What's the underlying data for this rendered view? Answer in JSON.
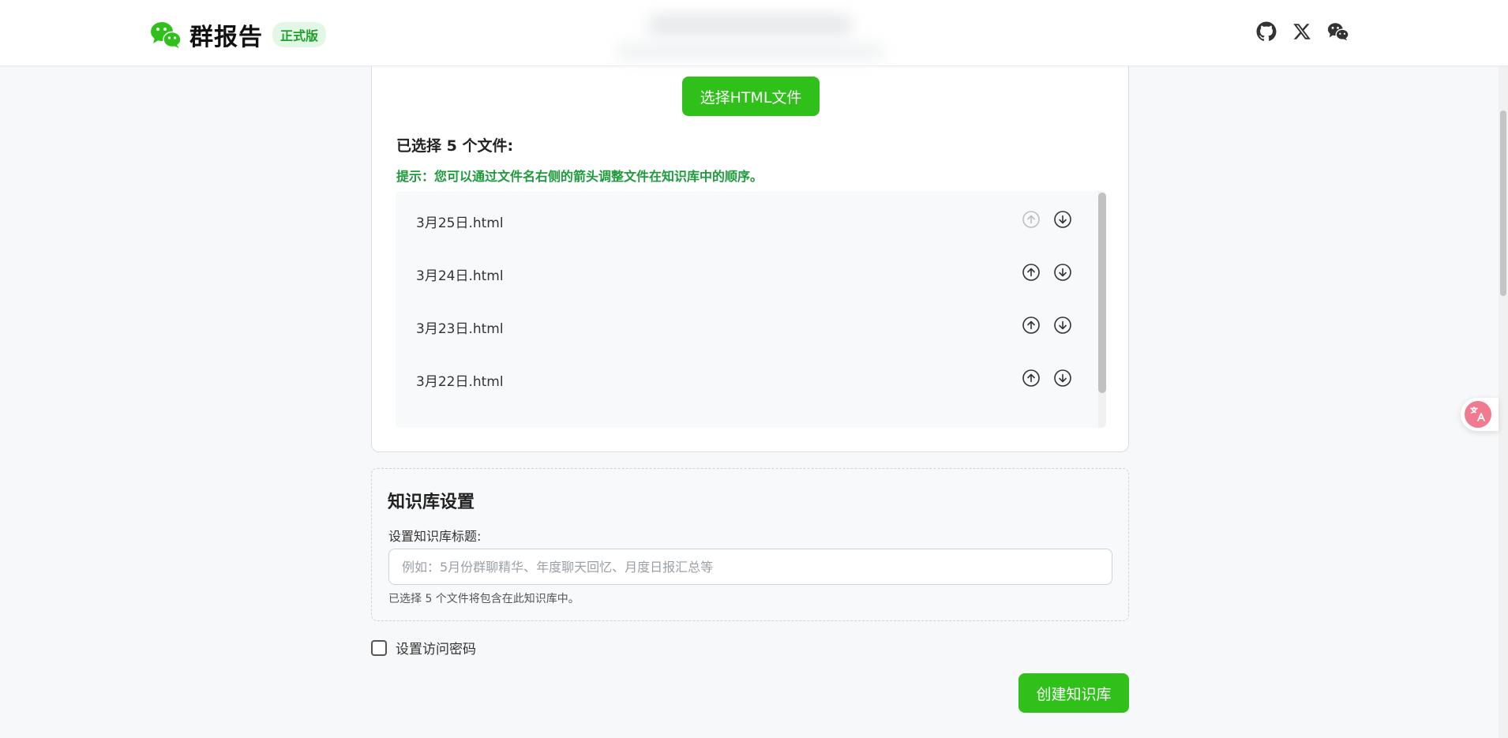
{
  "header": {
    "brand_name": "群报告",
    "brand_badge": "正式版",
    "icons": [
      "github-icon",
      "x-icon",
      "wechat-icon"
    ]
  },
  "upload": {
    "select_button": "选择HTML文件",
    "selected_count": "已选择 5 个文件:",
    "hint": "提示：您可以通过文件名右侧的箭头调整文件在知识库中的顺序。",
    "files": [
      {
        "name": "3月25日.html",
        "up_enabled": false
      },
      {
        "name": "3月24日.html",
        "up_enabled": true
      },
      {
        "name": "3月23日.html",
        "up_enabled": true
      },
      {
        "name": "3月22日.html",
        "up_enabled": true
      }
    ]
  },
  "settings": {
    "title": "知识库设置",
    "label": "设置知识库标题:",
    "placeholder": "例如：5月份群聊精华、年度聊天回忆、月度日报汇总等",
    "value": "",
    "note": "已选择 5 个文件将包含在此知识库中。"
  },
  "password": {
    "label": "设置访问密码",
    "checked": false
  },
  "create_button": "创建知识库",
  "colors": {
    "accent": "#2fc01a",
    "hint": "#1c9a3c",
    "badge_bg": "#e3f7e6",
    "translate": "#f07a8f"
  }
}
